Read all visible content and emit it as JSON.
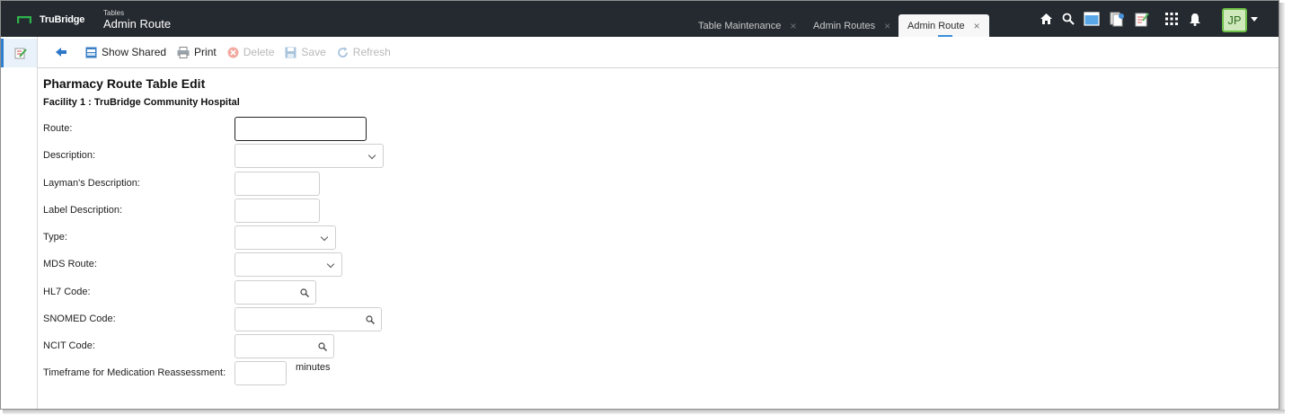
{
  "header": {
    "brand": "TruBridge",
    "breadcrumb_parent": "Tables",
    "breadcrumb_current": "Admin Route",
    "tabs": [
      {
        "label": "Table Maintenance",
        "close": "×"
      },
      {
        "label": "Admin Routes",
        "close": "×"
      },
      {
        "label": "Admin Route",
        "close": "×"
      }
    ],
    "user_initials": "JP"
  },
  "toolbar": {
    "show_shared": "Show Shared",
    "print": "Print",
    "delete": "Delete",
    "save": "Save",
    "refresh": "Refresh"
  },
  "form": {
    "title": "Pharmacy Route Table Edit",
    "facility": "Facility 1 : TruBridge Community Hospital",
    "route_label": "Route:",
    "route_value": "",
    "description_label": "Description:",
    "description_value": "",
    "layman_label": "Layman's Description:",
    "layman_value": "",
    "label_desc_label": "Label Description:",
    "label_desc_value": "",
    "type_label": "Type:",
    "type_value": "",
    "mds_label": "MDS Route:",
    "mds_value": "",
    "hl7_label": "HL7 Code:",
    "hl7_value": "",
    "snomed_label": "SNOMED Code:",
    "snomed_value": "",
    "ncit_label": "NCIT Code:",
    "ncit_value": "",
    "timeframe_label": "Timeframe for Medication Reassessment:",
    "timeframe_value": "",
    "timeframe_unit": "minutes"
  },
  "colors": {
    "topbar": "#242a30",
    "accent": "#3b8fd9",
    "brand_green": "#2fb34a"
  },
  "icons": [
    "home-icon",
    "search-icon",
    "window-icon",
    "documents-icon",
    "notes-icon",
    "apps-grid-icon",
    "bell-icon",
    "back-arrow-icon",
    "show-shared-icon",
    "print-icon",
    "delete-icon",
    "save-icon",
    "refresh-icon",
    "edit-note-icon"
  ]
}
